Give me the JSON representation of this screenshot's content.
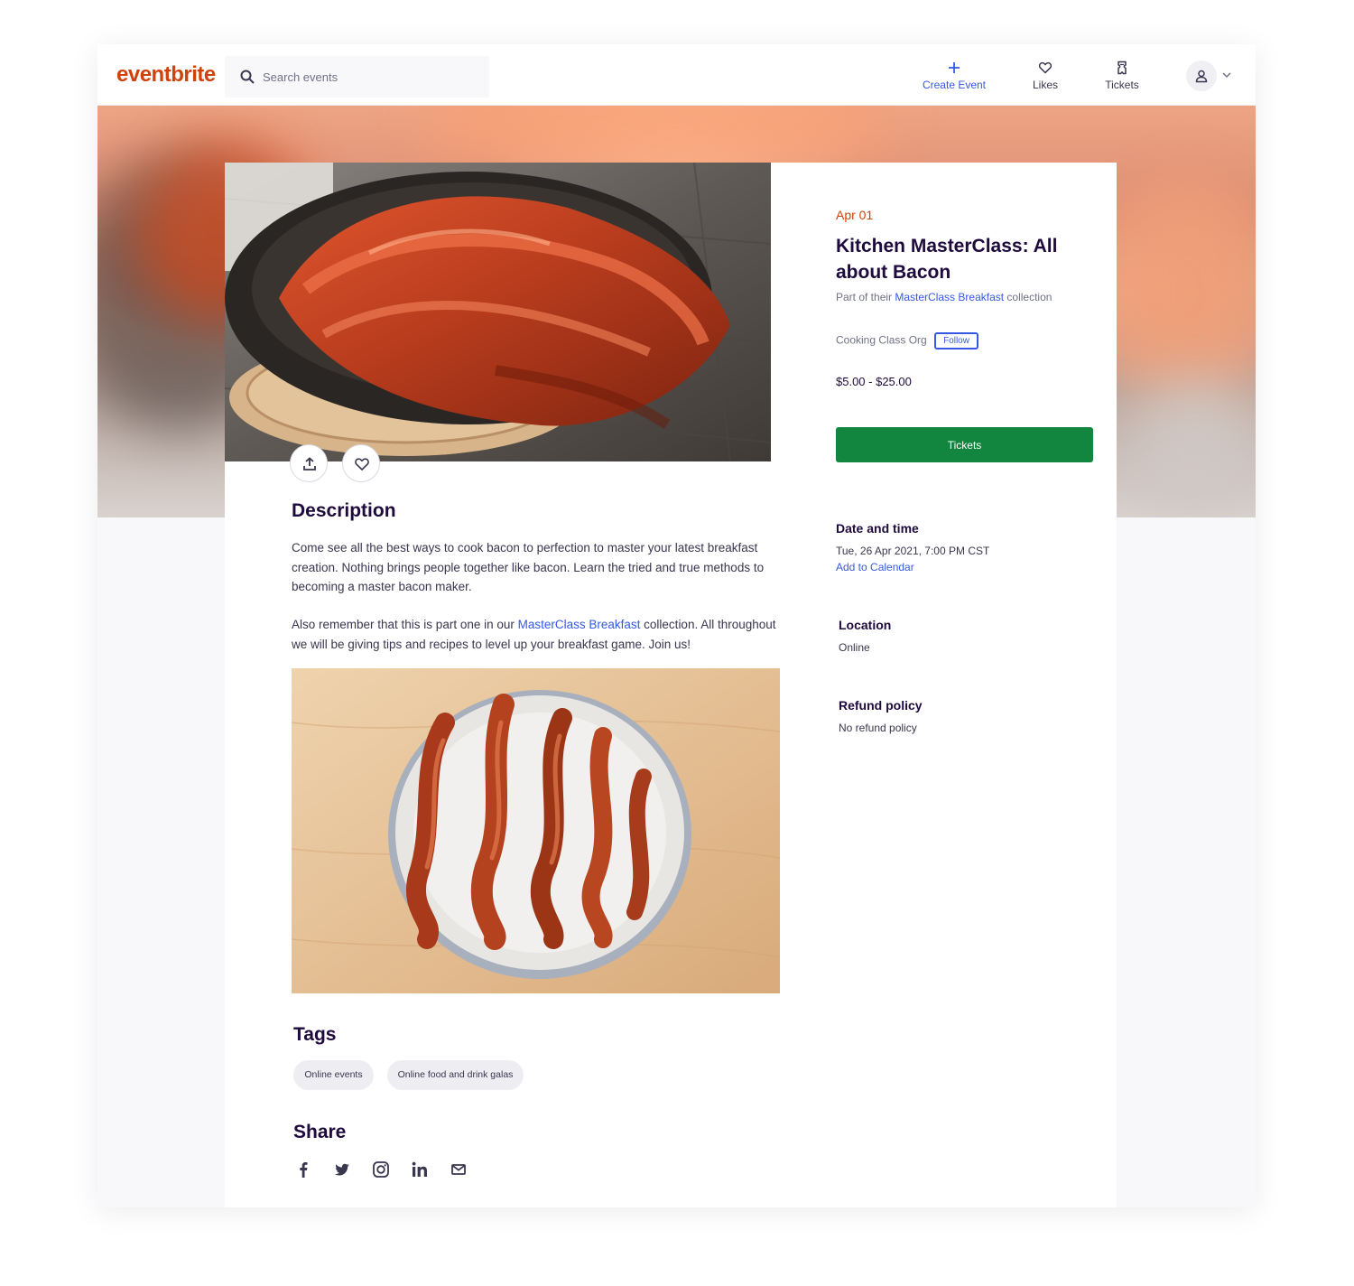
{
  "header": {
    "logo": "eventbrite",
    "search_placeholder": "Search events",
    "nav": {
      "create_event": "Create Event",
      "likes": "Likes",
      "tickets": "Tickets"
    }
  },
  "event": {
    "date_short": "Apr 01",
    "title": "Kitchen MasterClass: All about Bacon",
    "collection_prefix": "Part of their ",
    "collection_link": "MasterClass Breakfast",
    "collection_suffix": " collection",
    "organizer": "Cooking Class Org",
    "follow_label": "Follow",
    "price": "$5.00 - $25.00",
    "tickets_button": "Tickets"
  },
  "sidebar": {
    "date_heading": "Date and time",
    "date_value": "Tue, 26 Apr 2021, 7:00 PM CST",
    "add_to_calendar": "Add to Calendar",
    "location_heading": "Location",
    "location_value": "Online",
    "refund_heading": "Refund policy",
    "refund_value": "No refund policy"
  },
  "description": {
    "heading": "Description",
    "p1": "Come see all the best ways to cook bacon to perfection to master your latest breakfast creation. Nothing brings people together like bacon. Learn the tried and true methods to becoming a master bacon maker.",
    "p2_prefix": "Also remember that this is part one in our ",
    "p2_link": "MasterClass Breakfast",
    "p2_suffix": " collection. All throughout we will be giving tips and recipes to level up your breakfast game. Join us!"
  },
  "tags": {
    "heading": "Tags",
    "items": [
      "Online events",
      "Online food and drink galas"
    ]
  },
  "share": {
    "heading": "Share",
    "icons": [
      "facebook-icon",
      "twitter-icon",
      "instagram-icon",
      "linkedin-icon",
      "email-icon"
    ]
  },
  "colors": {
    "brand": "#d1410c",
    "link": "#3659e3",
    "cta": "#12853e"
  }
}
